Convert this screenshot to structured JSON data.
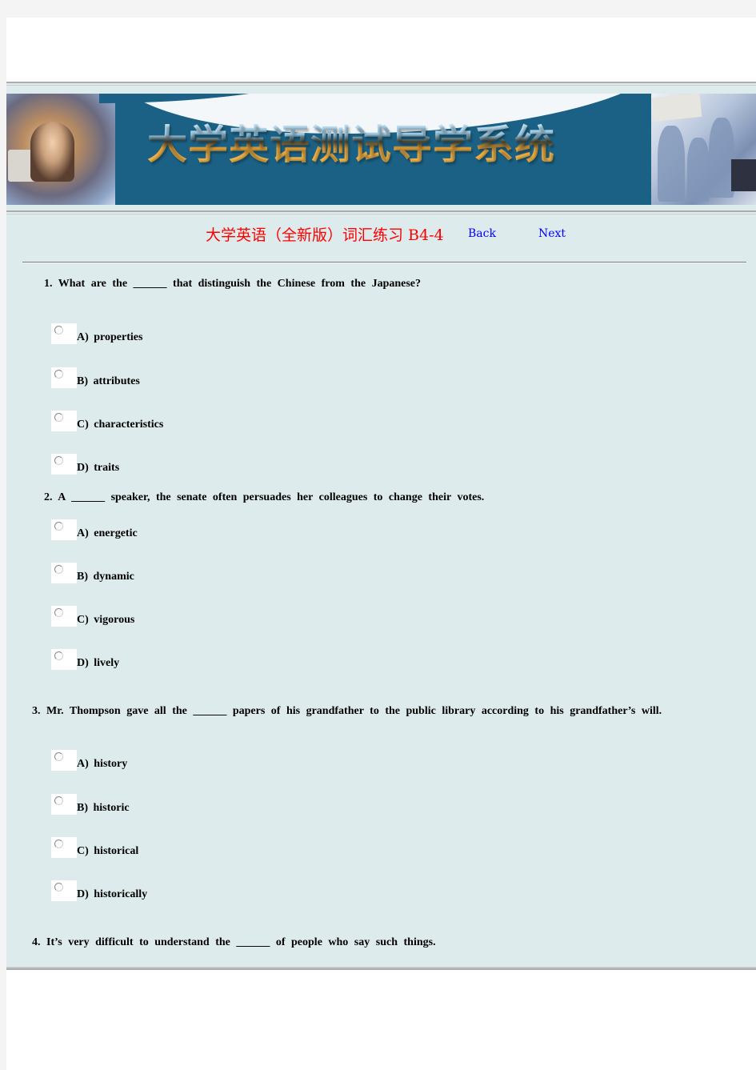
{
  "banner": {
    "title": "大学英语测试导学系统"
  },
  "header": {
    "title": "大学英语（全新版）词汇练习 B4-4",
    "back_label": "Back",
    "next_label": "Next"
  },
  "colors": {
    "title_red": "#ff0000",
    "link_blue": "#0000ff",
    "content_bg": "#deebec",
    "banner_blue": "#1b6185"
  },
  "questions": [
    {
      "text": "1. What are the ______ that distinguish the Chinese from the Japanese?",
      "options": [
        "A)  properties",
        "B)  attributes",
        "C)  characteristics",
        "D)  traits"
      ]
    },
    {
      "text": "2. A ______ speaker, the senate often persuades her colleagues to change their votes.",
      "options": [
        "A)  energetic",
        "B)  dynamic",
        "C)  vigorous",
        "D)  lively"
      ]
    },
    {
      "text": "3. Mr. Thompson gave all the ______ papers of his grandfather to the public library according to his grandfather’s will.",
      "options": [
        "A)  history",
        "B)  historic",
        "C)  historical",
        "D)  historically"
      ]
    },
    {
      "text": "4.  It’s very difficult to understand the ______ of people who say such things.",
      "options": []
    }
  ]
}
